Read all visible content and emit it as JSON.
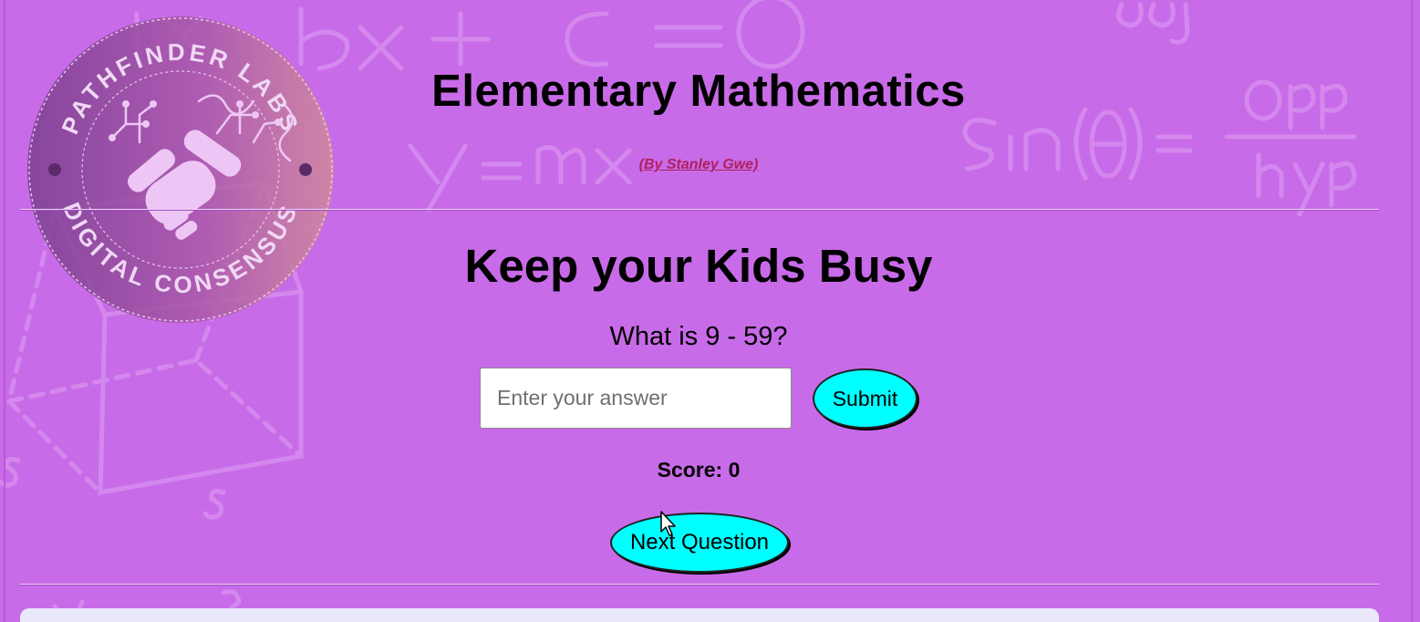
{
  "logo": {
    "top_text": "PATHFINDER LABS",
    "bottom_text": "DIGITAL CONSENSUS"
  },
  "header": {
    "title": "Elementary Mathematics",
    "author": "(By Stanley Gwe)"
  },
  "main": {
    "heading": "Keep your Kids Busy",
    "question": "What is 9 - 59?",
    "answer_placeholder": "Enter your answer",
    "answer_value": "",
    "submit_label": "Submit",
    "score_text": "Score: 0",
    "next_label": "Next Question"
  },
  "colors": {
    "background": "#c86be8",
    "button": "#00ffff",
    "author_link": "#b02060",
    "panel": "#e8e8fa"
  }
}
